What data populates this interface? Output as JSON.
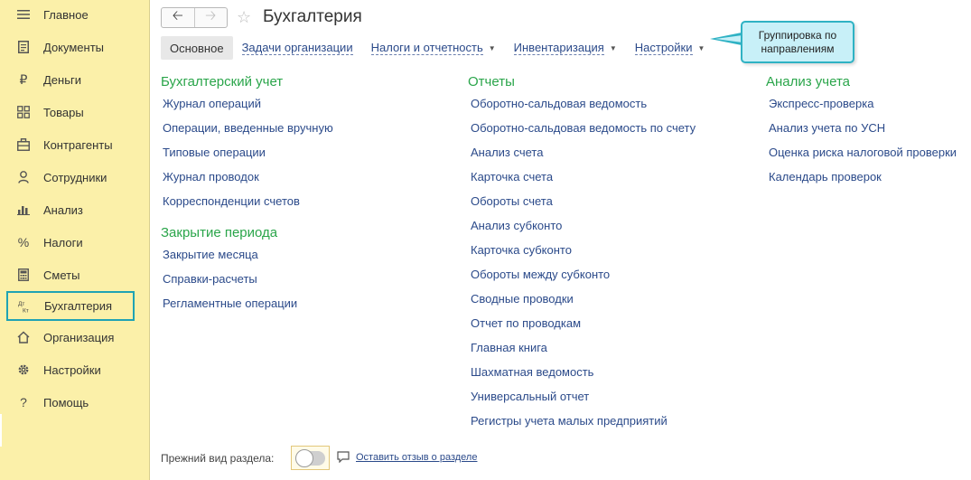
{
  "sidebar": {
    "items": [
      {
        "label": "Главное",
        "icon": "menu-icon"
      },
      {
        "label": "Документы",
        "icon": "document-icon"
      },
      {
        "label": "Деньги",
        "icon": "ruble-icon"
      },
      {
        "label": "Товары",
        "icon": "goods-icon"
      },
      {
        "label": "Контрагенты",
        "icon": "contractors-icon"
      },
      {
        "label": "Сотрудники",
        "icon": "person-icon"
      },
      {
        "label": "Анализ",
        "icon": "bar-chart-icon"
      },
      {
        "label": "Налоги",
        "icon": "percent-icon"
      },
      {
        "label": "Сметы",
        "icon": "calculator-icon"
      },
      {
        "label": "Бухгалтерия",
        "icon": "dt-kt-icon",
        "active": true
      },
      {
        "label": "Организация",
        "icon": "home-icon"
      },
      {
        "label": "Настройки",
        "icon": "gear-icon"
      },
      {
        "label": "Помощь",
        "icon": "question-icon"
      }
    ]
  },
  "header": {
    "title": "Бухгалтерия"
  },
  "tabs": [
    {
      "label": "Основное",
      "active": true
    },
    {
      "label": "Задачи организации"
    },
    {
      "label": "Налоги и отчетность",
      "dropdown": true
    },
    {
      "label": "Инвентаризация",
      "dropdown": true
    },
    {
      "label": "Настройки",
      "dropdown": true
    }
  ],
  "callout": {
    "line1": "Группировка по",
    "line2": "направлениям"
  },
  "sections": {
    "accounting": {
      "title": "Бухгалтерский учет",
      "links": [
        "Журнал операций",
        "Операции, введенные вручную",
        "Типовые операции",
        "Журнал проводок",
        "Корреспонденции счетов"
      ]
    },
    "closing": {
      "title": "Закрытие периода",
      "links": [
        "Закрытие месяца",
        "Справки-расчеты",
        "Регламентные операции"
      ]
    },
    "reports": {
      "title": "Отчеты",
      "links": [
        "Оборотно-сальдовая ведомость",
        "Оборотно-сальдовая ведомость по счету",
        "Анализ счета",
        "Карточка счета",
        "Обороты счета",
        "Анализ субконто",
        "Карточка субконто",
        "Обороты между субконто",
        "Сводные проводки",
        "Отчет по проводкам",
        "Главная книга",
        "Шахматная ведомость",
        "Универсальный отчет",
        "Регистры учета малых предприятий"
      ]
    },
    "analysis": {
      "title": "Анализ учета",
      "links": [
        "Экспресс-проверка",
        "Анализ учета по УСН",
        "Оценка риска налоговой проверки",
        "Календарь проверок"
      ]
    }
  },
  "footer": {
    "old_view_label": "Прежний вид раздела:",
    "feedback_link": "Оставить отзыв о разделе"
  },
  "colors": {
    "sidebar_bg": "#fbf0a9",
    "section_title": "#2aa54a",
    "link": "#2b4a8a",
    "active_outline": "#1fa3b4",
    "callout_bg": "#c8f0f8"
  }
}
